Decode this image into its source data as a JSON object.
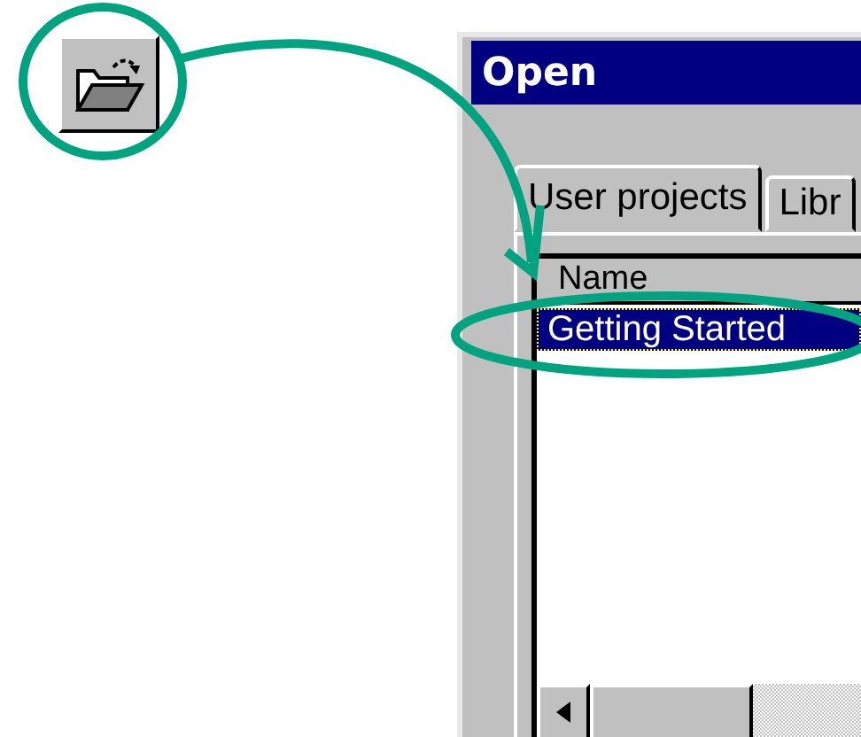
{
  "toolbar": {
    "open_button": {
      "pressed": false
    }
  },
  "dialog": {
    "title": "Open",
    "tabs": [
      {
        "label": "User projects",
        "selected": true
      },
      {
        "label": "Libr",
        "selected": false
      }
    ],
    "list": {
      "columns": [
        "Name"
      ],
      "rows": [
        {
          "name": "Getting Started",
          "selected": true
        }
      ]
    }
  }
}
